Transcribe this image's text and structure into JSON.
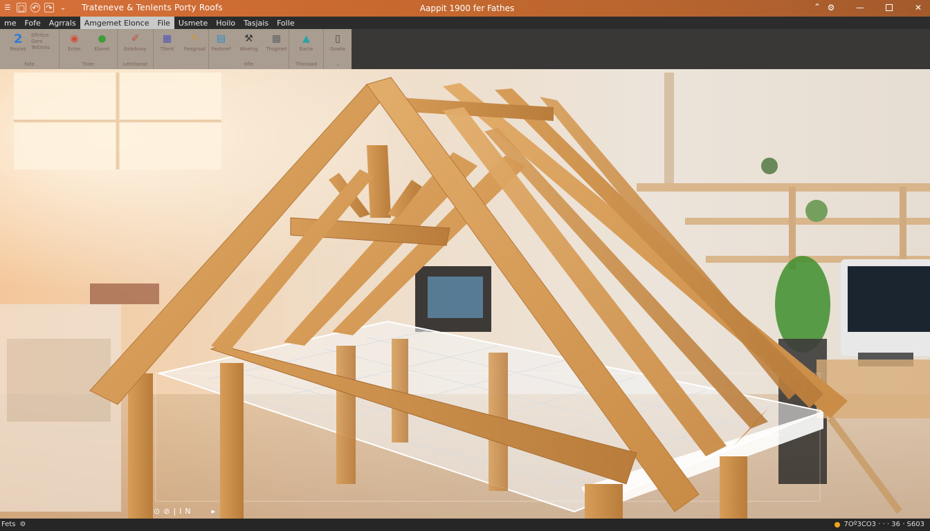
{
  "window": {
    "title_left": "Trateneve & Tenlents Porty Roofs",
    "title_center": "Aappit 1900 fer Fathes"
  },
  "menu": {
    "items": [
      {
        "label": "me"
      },
      {
        "label": "Fofe"
      },
      {
        "label": "Agrrals"
      },
      {
        "label": "Amgemet Elonce"
      },
      {
        "label": "File",
        "active": true
      },
      {
        "label": "Usmete"
      },
      {
        "label": "Hoilo"
      },
      {
        "label": "Tasjais"
      },
      {
        "label": "Folle"
      }
    ]
  },
  "ribbon": {
    "groups": [
      {
        "label": "Fafe",
        "lead_glyph": "2",
        "lead_label": "Reoies",
        "stack": [
          "Dfirtice",
          "Gers",
          "TelDinis"
        ]
      },
      {
        "label": "Tiote",
        "buttons": [
          {
            "icon": "paint-icon",
            "label": "Enter"
          },
          {
            "icon": "globe-icon",
            "label": "Elanet"
          }
        ]
      },
      {
        "label": "Letnlianat",
        "buttons": [
          {
            "icon": "brush-icon",
            "label": "Estebuny"
          }
        ]
      },
      {
        "label": "",
        "buttons": [
          {
            "icon": "grid-icon",
            "label": "Tilent"
          },
          {
            "icon": "pencil-icon",
            "label": "Feagnsal"
          }
        ]
      },
      {
        "label": "Hfle",
        "buttons": [
          {
            "icon": "folder-icon",
            "label": "Festeref"
          },
          {
            "icon": "tool-icon",
            "label": "Woeing"
          },
          {
            "icon": "stamp-icon",
            "label": "Thsgmet"
          }
        ]
      },
      {
        "label": "Thinlawd",
        "buttons": [
          {
            "icon": "shape-icon",
            "label": "Eacte"
          }
        ]
      },
      {
        "label": "",
        "buttons": [
          {
            "icon": "document-icon",
            "label": "Gowla"
          }
        ]
      }
    ]
  },
  "viewport_controls": [
    "⊙",
    "⊘",
    "|",
    "I",
    "N",
    "",
    "▸"
  ],
  "status": {
    "left": "Fets",
    "right": "7Oº3CO3 · · · 36 · S603"
  },
  "colors": {
    "titlebar": "#c8692f",
    "menubar": "#2c2c2c",
    "ribbon": "#c8b8aa",
    "wood": "#d19a55"
  }
}
